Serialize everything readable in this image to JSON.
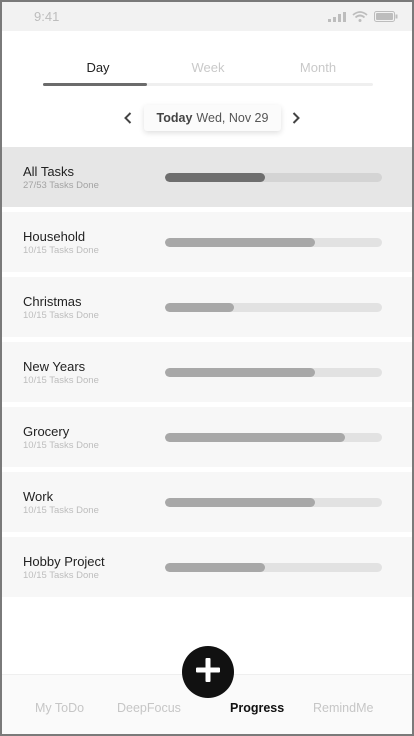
{
  "status_bar": {
    "time": "9:41",
    "icons": [
      "signal-icon",
      "wifi-icon",
      "battery-icon"
    ]
  },
  "period_tabs": {
    "items": [
      "Day",
      "Week",
      "Month"
    ],
    "active": "Day"
  },
  "date_nav": {
    "today_label": "Today",
    "date": "Wed, Nov 29",
    "prev_icon": "chevron-left-icon",
    "next_icon": "chevron-right-icon"
  },
  "task_groups": [
    {
      "name": "All Tasks",
      "status": "27/53 Tasks Done",
      "progress": 0.46,
      "selected": true
    },
    {
      "name": "Household",
      "status": "10/15 Tasks Done",
      "progress": 0.69
    },
    {
      "name": "Christmas",
      "status": "10/15 Tasks Done",
      "progress": 0.32
    },
    {
      "name": "New Years",
      "status": "10/15 Tasks Done",
      "progress": 0.69
    },
    {
      "name": "Grocery",
      "status": "10/15 Tasks Done",
      "progress": 0.83
    },
    {
      "name": "Work",
      "status": "10/15 Tasks Done",
      "progress": 0.69
    },
    {
      "name": "Hobby Project",
      "status": "10/15 Tasks Done",
      "progress": 0.46
    }
  ],
  "fab": {
    "icon": "plus-icon"
  },
  "bottom_nav": {
    "items": [
      "My ToDo",
      "DeepFocus",
      "Progress",
      "RemindMe"
    ],
    "active": "Progress"
  },
  "colors": {
    "accent": "#111111",
    "selected_row": "#e6e6e6",
    "row": "#f7f7f7",
    "bar_fill": "#a8a8a8",
    "bar_fill_selected": "#6e6e6e"
  }
}
